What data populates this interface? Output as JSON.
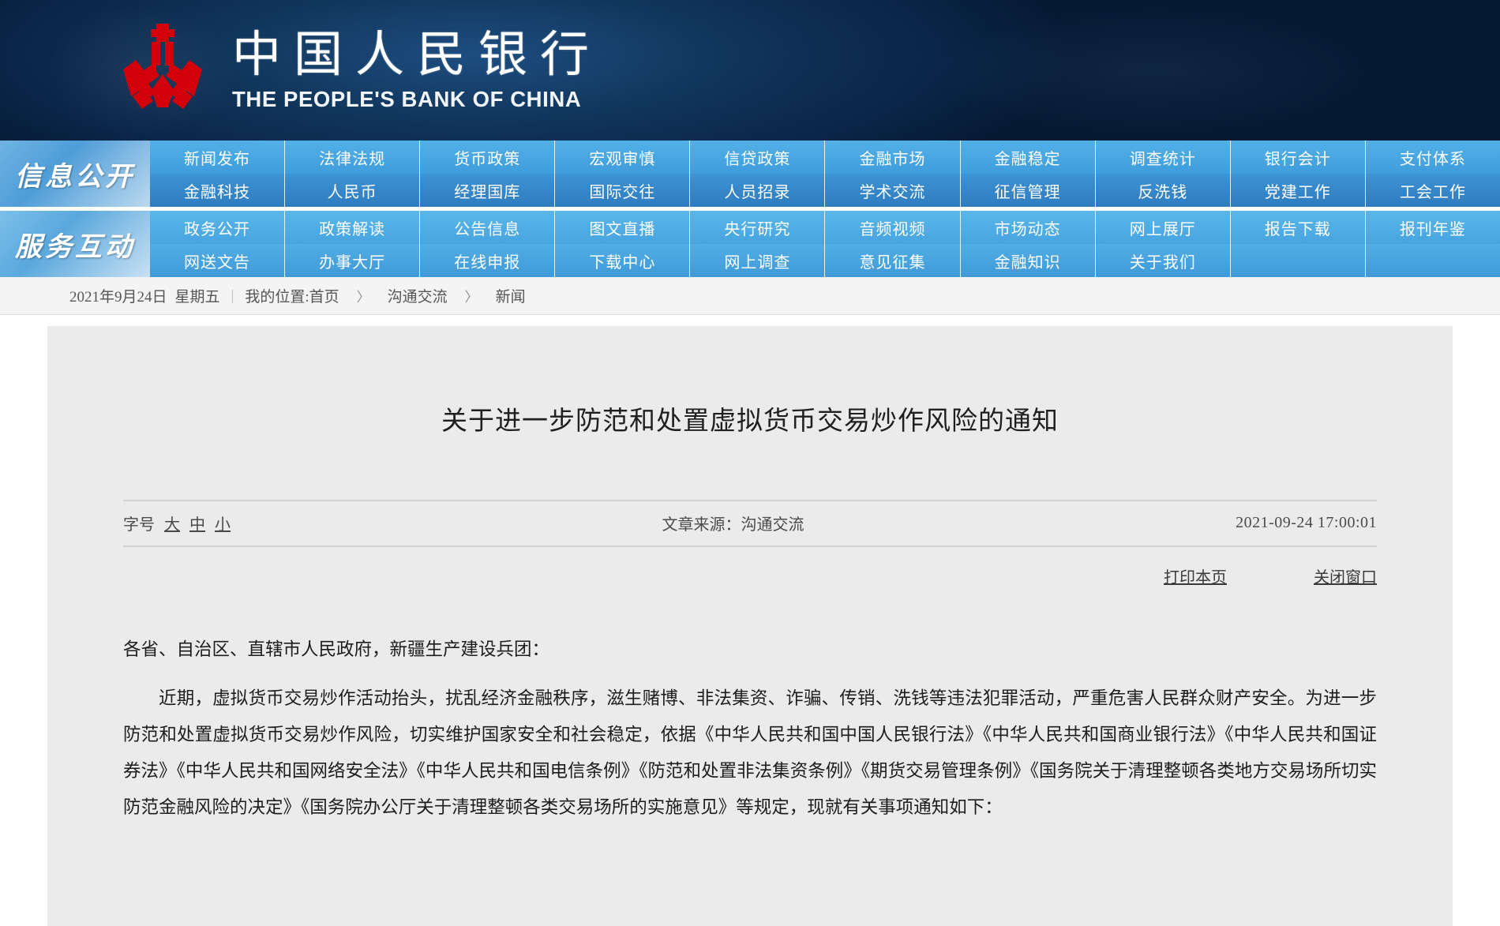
{
  "header": {
    "logo_icon": "pbc-emblem-icon",
    "name_cn": "中国人民银行",
    "name_en": "THE PEOPLE'S BANK OF CHINA",
    "brand_color": "#d2000a",
    "background_color": "#0b2a4e"
  },
  "nav": {
    "blocks": [
      {
        "label": "信息公开",
        "rows": [
          [
            "新闻发布",
            "法律法规",
            "货币政策",
            "宏观审慎",
            "信贷政策",
            "金融市场",
            "金融稳定",
            "调查统计",
            "银行会计",
            "支付体系"
          ],
          [
            "金融科技",
            "人民币",
            "经理国库",
            "国际交往",
            "人员招录",
            "学术交流",
            "征信管理",
            "反洗钱",
            "党建工作",
            "工会工作"
          ]
        ]
      },
      {
        "label": "服务互动",
        "rows": [
          [
            "政务公开",
            "政策解读",
            "公告信息",
            "图文直播",
            "央行研究",
            "音频视频",
            "市场动态",
            "网上展厅",
            "报告下载",
            "报刊年鉴"
          ],
          [
            "网送文告",
            "办事大厅",
            "在线申报",
            "下载中心",
            "网上调查",
            "意见征集",
            "金融知识",
            "关于我们",
            "",
            ""
          ]
        ]
      }
    ]
  },
  "crumb": {
    "date": "2021年9月24日",
    "weekday": "星期五",
    "position_label": "我的位置:",
    "items": [
      "首页",
      "沟通交流",
      "新闻"
    ],
    "chevron_icon": "chevron-right-icon"
  },
  "article": {
    "title": "关于进一步防范和处置虚拟货币交易炒作风险的通知",
    "fontsize_label": "字号",
    "fontsize_options": [
      "大",
      "中",
      "小"
    ],
    "source": "文章来源：沟通交流",
    "timestamp": "2021-09-24  17:00:01",
    "print_label": "打印本页",
    "close_label": "关闭窗口",
    "paragraphs": [
      {
        "indent": false,
        "text": "各省、自治区、直辖市人民政府，新疆生产建设兵团："
      },
      {
        "indent": true,
        "text": "近期，虚拟货币交易炒作活动抬头，扰乱经济金融秩序，滋生赌博、非法集资、诈骗、传销、洗钱等违法犯罪活动，严重危害人民群众财产安全。为进一步防范和处置虚拟货币交易炒作风险，切实维护国家安全和社会稳定，依据《中华人民共和国中国人民银行法》《中华人民共和国商业银行法》《中华人民共和国证券法》《中华人民共和国网络安全法》《中华人民共和国电信条例》《防范和处置非法集资条例》《期货交易管理条例》《国务院关于清理整顿各类地方交易场所切实防范金融风险的决定》《国务院办公厅关于清理整顿各类交易场所的实施意见》等规定，现就有关事项通知如下："
      }
    ]
  }
}
